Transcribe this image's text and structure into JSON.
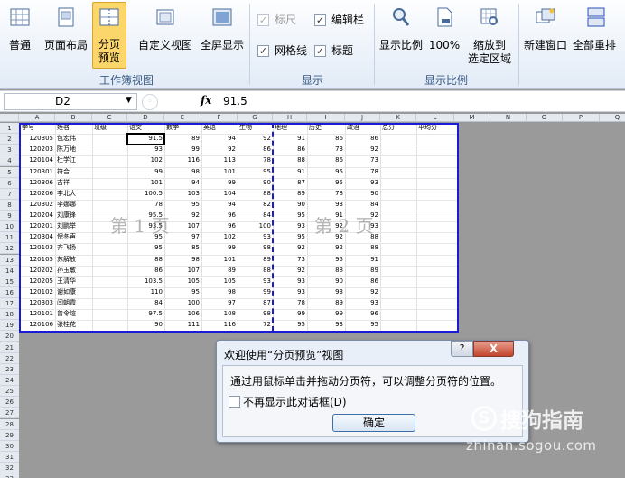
{
  "ribbon": {
    "groups": {
      "views_label": "工作簿视图",
      "show_label": "显示",
      "zoom_label": "显示比例"
    },
    "buttons": {
      "normal": "普通",
      "page_layout": "页面布局",
      "page_break_preview_1": "分页",
      "page_break_preview_2": "预览",
      "custom_views": "自定义视图",
      "full_screen": "全屏显示",
      "zoom": "显示比例",
      "zoom_100": "100%",
      "zoom_selection_1": "缩放到",
      "zoom_selection_2": "选定区域",
      "new_window": "新建窗口",
      "arrange_all": "全部重排"
    },
    "checkboxes": {
      "ruler": "标尺",
      "formula_bar": "编辑栏",
      "gridlines": "网格线",
      "headings": "标题"
    },
    "colors": {
      "active_tab": "#fbd66b",
      "group_label": "#3b5b84"
    }
  },
  "formula_bar": {
    "name_box": "D2",
    "fx_label": "fx",
    "value": "91.5"
  },
  "sheet": {
    "columns": [
      "A",
      "B",
      "C",
      "D",
      "E",
      "F",
      "G",
      "H",
      "I",
      "J",
      "K",
      "L",
      "M",
      "N",
      "O",
      "P",
      "Q"
    ],
    "rows": [
      "1",
      "2",
      "3",
      "4",
      "5",
      "6",
      "7",
      "8",
      "9",
      "10",
      "11",
      "12",
      "13",
      "14",
      "15",
      "16",
      "17",
      "18",
      "19",
      "20",
      "21",
      "22",
      "23",
      "24",
      "25",
      "26",
      "27",
      "28",
      "29",
      "30",
      "31",
      "32",
      "33"
    ],
    "headers": [
      "学号",
      "姓名",
      "班级",
      "语文",
      "数学",
      "英语",
      "生物",
      "地理",
      "历史",
      "政治",
      "总分",
      "平均分"
    ],
    "data": [
      [
        "120305",
        "包宏伟",
        "",
        "91.5",
        "89",
        "94",
        "92",
        "91",
        "86",
        "86"
      ],
      [
        "120203",
        "陈万地",
        "",
        "93",
        "99",
        "92",
        "86",
        "86",
        "73",
        "92"
      ],
      [
        "120104",
        "杜学江",
        "",
        "102",
        "116",
        "113",
        "78",
        "88",
        "86",
        "73"
      ],
      [
        "120301",
        "符合",
        "",
        "99",
        "98",
        "101",
        "95",
        "91",
        "95",
        "78"
      ],
      [
        "120306",
        "吉祥",
        "",
        "101",
        "94",
        "99",
        "90",
        "87",
        "95",
        "93"
      ],
      [
        "120206",
        "李北大",
        "",
        "100.5",
        "103",
        "104",
        "88",
        "89",
        "78",
        "90"
      ],
      [
        "120302",
        "李娜娜",
        "",
        "78",
        "95",
        "94",
        "82",
        "90",
        "93",
        "84"
      ],
      [
        "120204",
        "刘康锋",
        "",
        "95.5",
        "92",
        "96",
        "84",
        "95",
        "91",
        "92"
      ],
      [
        "120201",
        "刘鹏举",
        "",
        "93.5",
        "107",
        "96",
        "100",
        "93",
        "92",
        "93"
      ],
      [
        "120304",
        "倪冬声",
        "",
        "95",
        "97",
        "102",
        "93",
        "95",
        "92",
        "88"
      ],
      [
        "120103",
        "齐飞扬",
        "",
        "95",
        "85",
        "99",
        "98",
        "92",
        "92",
        "88"
      ],
      [
        "120105",
        "苏解放",
        "",
        "88",
        "98",
        "101",
        "89",
        "73",
        "95",
        "91"
      ],
      [
        "120202",
        "孙玉敏",
        "",
        "86",
        "107",
        "89",
        "88",
        "92",
        "88",
        "89"
      ],
      [
        "120205",
        "王清华",
        "",
        "103.5",
        "105",
        "105",
        "93",
        "93",
        "90",
        "86"
      ],
      [
        "120102",
        "谢如康",
        "",
        "110",
        "95",
        "98",
        "99",
        "93",
        "93",
        "92"
      ],
      [
        "120303",
        "闫朝霞",
        "",
        "84",
        "100",
        "97",
        "87",
        "78",
        "89",
        "93"
      ],
      [
        "120101",
        "曾令煊",
        "",
        "97.5",
        "106",
        "108",
        "98",
        "99",
        "99",
        "96"
      ],
      [
        "120106",
        "张桂花",
        "",
        "90",
        "111",
        "116",
        "72",
        "95",
        "93",
        "95"
      ]
    ],
    "watermarks": {
      "page1": "第 1 页",
      "page2": "第 2 页"
    },
    "colors": {
      "page_border": "#1b1bd6"
    }
  },
  "dialog": {
    "title": "欢迎使用“分页预览”视图",
    "help": "?",
    "close": "X",
    "message": "通过用鼠标单击并拖动分页符，可以调整分页符的位置。",
    "checkbox_label": "不再显示此对话框(D)",
    "ok": "确定"
  },
  "branding": {
    "logo_glyph": "S",
    "name": "搜狗指南",
    "url": "zhinan.sogou.com"
  }
}
